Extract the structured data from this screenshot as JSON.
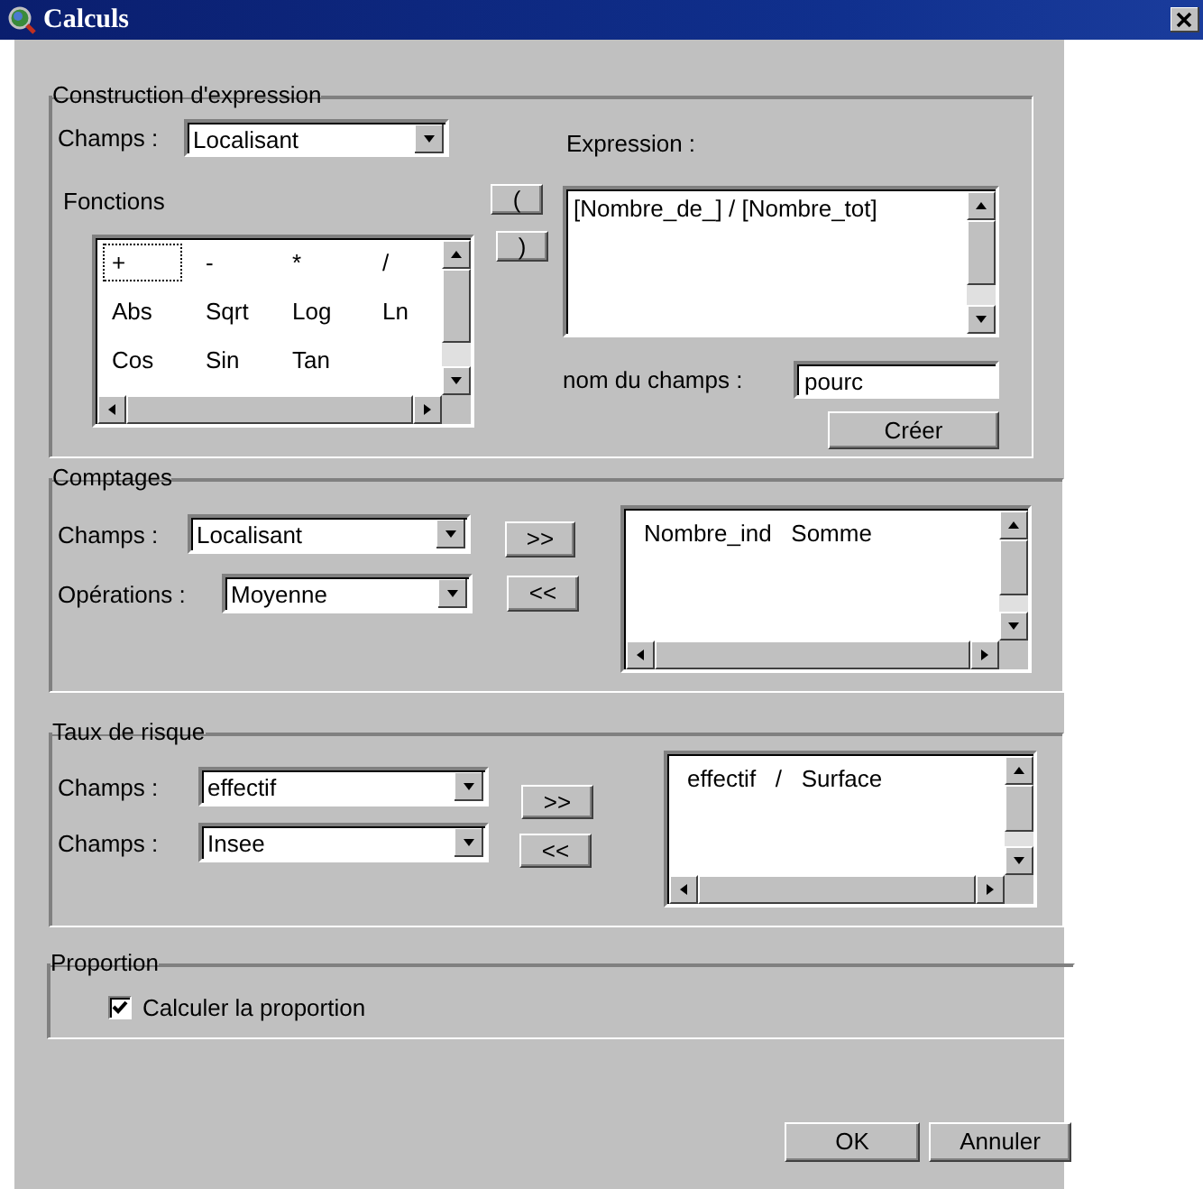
{
  "window": {
    "title": "Calculs"
  },
  "expression_group": {
    "title": "Construction d'expression",
    "field_label": "Champs :",
    "field_value": "Localisant",
    "functions_label": "Fonctions",
    "functions": [
      [
        {
          "label": "+",
          "focused": true
        },
        {
          "label": "-",
          "focused": false
        },
        {
          "label": "*",
          "focused": false
        },
        {
          "label": "/",
          "focused": false
        }
      ],
      [
        {
          "label": "Abs",
          "focused": false
        },
        {
          "label": "Sqrt",
          "focused": false
        },
        {
          "label": "Log",
          "focused": false
        },
        {
          "label": "Ln",
          "focused": false
        }
      ],
      [
        {
          "label": "Cos",
          "focused": false
        },
        {
          "label": "Sin",
          "focused": false
        },
        {
          "label": "Tan",
          "focused": false
        }
      ]
    ],
    "open_paren": "(",
    "close_paren": ")",
    "expression_label": "Expression :",
    "expression": "[Nombre_de_] / [Nombre_tot]",
    "name_label": "nom du champs :",
    "name_value": "pourc",
    "create_button": "Créer"
  },
  "counts_group": {
    "title": "Comptages",
    "selects": [
      {
        "label": "Champs :",
        "value": "Localisant"
      },
      {
        "label": "Opérations :",
        "value": "Moyenne"
      }
    ],
    "add_button": ">>",
    "remove_button": "<<",
    "list": [
      [
        "Nombre_ind",
        "Somme"
      ]
    ]
  },
  "risk_group": {
    "title": "Taux de risque",
    "selects": [
      {
        "label": "Champs :",
        "value": "effectif"
      },
      {
        "label": "Champs :",
        "value": "Insee"
      }
    ],
    "add_button": ">>",
    "remove_button": "<<",
    "list": [
      [
        "effectif",
        "/",
        "Surface"
      ]
    ]
  },
  "proportion_group": {
    "title": "Proportion",
    "checkbox": {
      "label": "Calculer la proportion",
      "checked": true
    }
  },
  "buttons": [
    "OK",
    "Annuler"
  ]
}
